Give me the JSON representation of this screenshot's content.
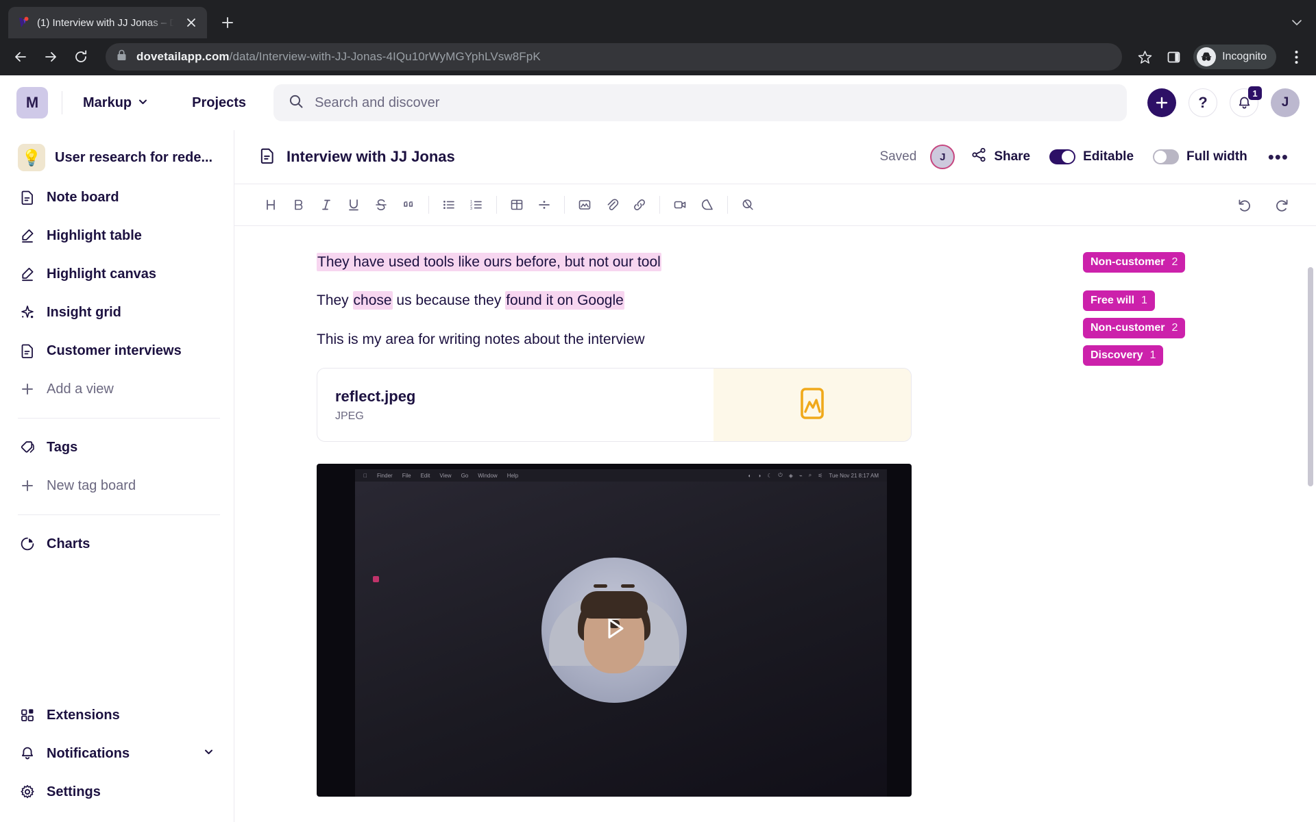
{
  "browser": {
    "tab": {
      "title": "(1) Interview with JJ Jonas – D",
      "favicon_name": "dovetail-favicon",
      "close_label": "✕"
    },
    "new_tab_label": "+",
    "nav": {
      "back": "←",
      "forward": "→",
      "reload": "⟳"
    },
    "omnibox": {
      "lock_icon": "lock-icon",
      "url_domain": "dovetailapp.com",
      "url_path": "/data/Interview-with-JJ-Jonas-4IQu10rWyMGYphLVsw8FpK"
    },
    "bookmark_label": "☆",
    "sidepanel_label": "side-panel-icon",
    "profile": {
      "label": "Incognito",
      "icon": "incognito-icon"
    },
    "menu_label": "⋮",
    "window_chevron": "⌄"
  },
  "header": {
    "org_initial": "M",
    "workspace": "Markup",
    "workspace_chevron": "⌄",
    "projects_link": "Projects",
    "search": {
      "placeholder": "Search and discover",
      "icon": "search-icon"
    },
    "create_label": "+",
    "help_label": "?",
    "notifications": {
      "icon": "bell-icon",
      "count": "1"
    },
    "avatar_initial": "J"
  },
  "sidebar": {
    "project": {
      "emoji": "💡",
      "name": "User research for rede..."
    },
    "views": [
      {
        "label": "Note board",
        "icon": "note-icon"
      },
      {
        "label": "Highlight table",
        "icon": "highlighter-icon"
      },
      {
        "label": "Highlight canvas",
        "icon": "highlighter-icon"
      },
      {
        "label": "Insight grid",
        "icon": "sparkle-icon"
      },
      {
        "label": "Customer interviews",
        "icon": "note-icon"
      }
    ],
    "add_view": {
      "label": "Add a view",
      "icon": "plus-icon"
    },
    "tags": {
      "label": "Tags",
      "icon": "tag-icon"
    },
    "new_tag_board": {
      "label": "New tag board",
      "icon": "plus-icon"
    },
    "charts": {
      "label": "Charts",
      "icon": "pie-chart-icon"
    },
    "bottom": [
      {
        "label": "Extensions",
        "icon": "extensions-icon",
        "chevron": ""
      },
      {
        "label": "Notifications",
        "icon": "bell-icon",
        "chevron": "⌄"
      },
      {
        "label": "Settings",
        "icon": "gear-icon",
        "chevron": ""
      }
    ]
  },
  "document": {
    "title": "Interview with JJ Jonas",
    "title_icon": "note-icon",
    "saved_status": "Saved",
    "collaborator_initial": "J",
    "share_label": "Share",
    "editable_label": "Editable",
    "editable_on": true,
    "full_width_label": "Full width",
    "full_width_on": false,
    "more_label": "•••",
    "toolbar": {
      "groups": [
        [
          {
            "label": "H",
            "name": "heading-button"
          },
          {
            "label": "B",
            "name": "bold-button"
          },
          {
            "label": "I",
            "name": "italic-button"
          },
          {
            "label": "U",
            "name": "underline-button"
          },
          {
            "label": "S",
            "name": "strikethrough-button"
          },
          {
            "label": "❞",
            "name": "blockquote-button"
          }
        ],
        [
          {
            "label": "•≡",
            "name": "bulleted-list-button"
          },
          {
            "label": "1≡",
            "name": "numbered-list-button"
          }
        ],
        [
          {
            "label": "⊞",
            "name": "table-button"
          },
          {
            "label": "÷",
            "name": "divider-button"
          }
        ],
        [
          {
            "label": "▣",
            "name": "image-button"
          },
          {
            "label": "📎",
            "name": "attachment-button"
          },
          {
            "label": "🔗",
            "name": "link-button"
          }
        ],
        [
          {
            "label": "🎥",
            "name": "video-button"
          },
          {
            "label": "◬",
            "name": "drive-button"
          }
        ],
        [
          {
            "label": "⌕",
            "name": "find-button"
          }
        ]
      ],
      "undo_label": "↶",
      "redo_label": "↷"
    },
    "paragraphs": [
      {
        "segments": [
          {
            "text": "They have used tools like ours before, but not our tool",
            "highlight": true
          }
        ]
      },
      {
        "segments": [
          {
            "text": "They ",
            "highlight": false
          },
          {
            "text": "chose",
            "highlight": true
          },
          {
            "text": " us because they ",
            "highlight": false
          },
          {
            "text": "found it on Google",
            "highlight": true
          }
        ]
      },
      {
        "segments": [
          {
            "text": "This is my area for writing notes about the interview",
            "highlight": false
          }
        ]
      }
    ],
    "file_card": {
      "name": "reflect.jpeg",
      "type": "JPEG",
      "thumb_icon": "image-icon",
      "thumb_color": "#f0a91b"
    },
    "video": {
      "play_label": "▶",
      "menubar_items": [
        "",
        "Finder",
        "File",
        "Edit",
        "View",
        "Go",
        "Window",
        "Help"
      ],
      "menubar_clock": "Tue Nov 21  8:17 AM",
      "recording_indicator": "recording-dot"
    }
  },
  "tags_rail": {
    "groups": [
      {
        "tags": [
          {
            "label": "Non-customer",
            "count": "2"
          }
        ]
      },
      {
        "tags": [
          {
            "label": "Free will",
            "count": "1"
          },
          {
            "label": "Non-customer",
            "count": "2"
          },
          {
            "label": "Discovery",
            "count": "1"
          }
        ]
      }
    ],
    "color": "#cc21ab"
  }
}
